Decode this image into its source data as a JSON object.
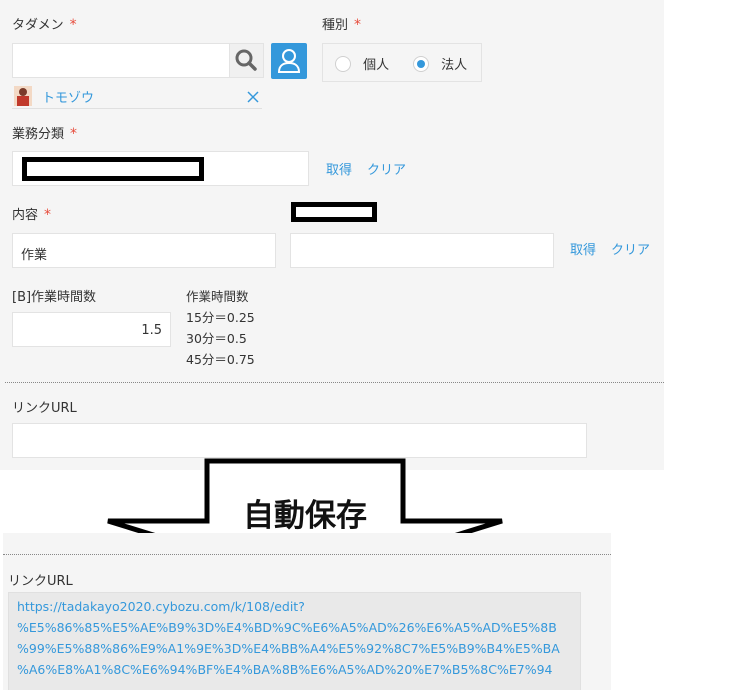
{
  "tadamen": {
    "label": "タダメン",
    "required": "*",
    "search_value": "",
    "selected_user": "トモゾウ"
  },
  "shubetsu": {
    "label": "種別",
    "required": "*",
    "options": [
      "個人",
      "法人"
    ],
    "selected": "法人"
  },
  "gyomu": {
    "label": "業務分類",
    "required": "*",
    "get": "取得",
    "clear": "クリア"
  },
  "naiyou": {
    "label": "内容",
    "required": "*",
    "value": "作業",
    "get": "取得",
    "clear": "クリア"
  },
  "hours": {
    "label": "[B]作業時間数",
    "value": "1.5",
    "note_title": "作業時間数",
    "notes": [
      "15分＝0.25",
      "30分＝0.5",
      "45分＝0.75"
    ]
  },
  "link_url": {
    "label": "リンクURL",
    "value": ""
  },
  "arrow": {
    "text": "自動保存"
  },
  "saved": {
    "label": "リンクURL",
    "url_lines": [
      "https://tadakayo2020.cybozu.com/k/108/edit?",
      "%E5%86%85%E5%AE%B9%3D%E4%BD%9C%E6%A5%AD%26%E6%A5%AD%E5%8B",
      "%99%E5%88%86%E9%A1%9E%3D%E4%BB%A4%E5%92%8C7%E5%B9%B4%E5%BA",
      "%A6%E8%A1%8C%E6%94%BF%E4%BA%8B%E6%A5%AD%20%E7%B5%8C%E7%94"
    ]
  }
}
